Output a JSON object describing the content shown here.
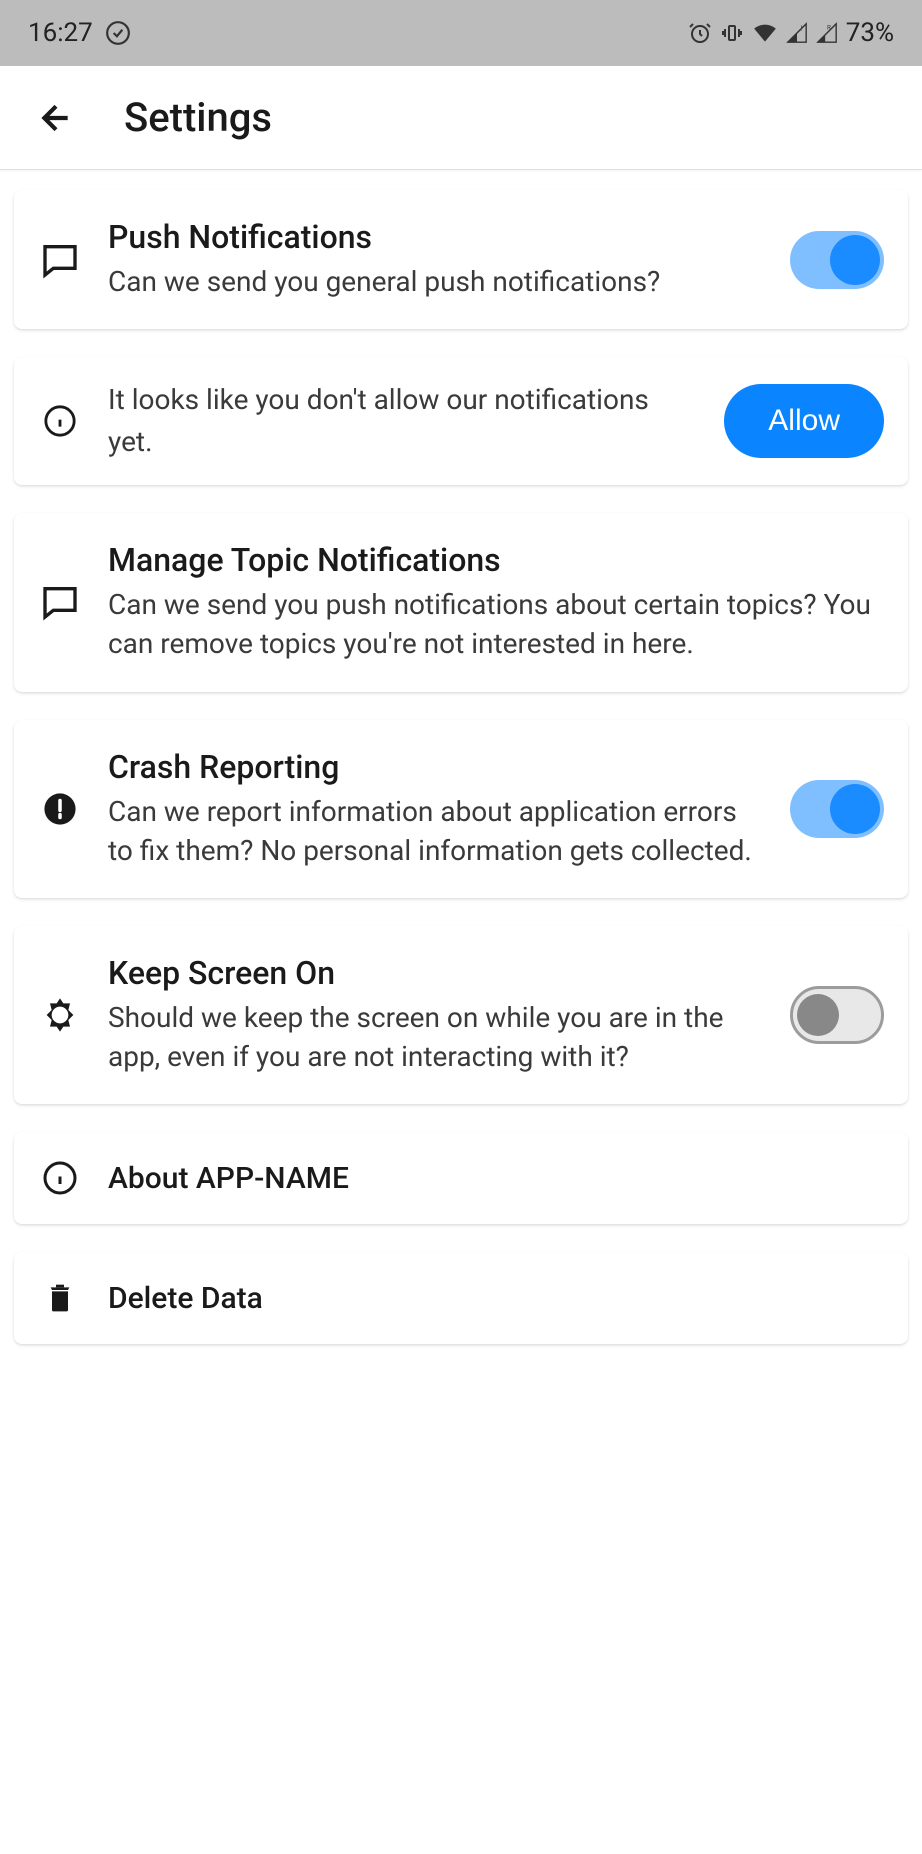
{
  "status_bar": {
    "time": "16:27",
    "battery": "73%"
  },
  "header": {
    "title": "Settings"
  },
  "settings": {
    "push_notifications": {
      "title": "Push Notifications",
      "subtitle": "Can we send you general push notifications?",
      "enabled": true
    },
    "notification_prompt": {
      "text": "It looks like you don't allow our notifications yet.",
      "button": "Allow"
    },
    "topic_notifications": {
      "title": "Manage Topic Notifications",
      "subtitle": "Can we send you push notifications about certain topics? You can remove topics you're not interested in here."
    },
    "crash_reporting": {
      "title": "Crash Reporting",
      "subtitle": "Can we report information about application errors to fix them? No personal information gets collected.",
      "enabled": true
    },
    "keep_screen_on": {
      "title": "Keep Screen On",
      "subtitle": "Should we keep the screen on while you are in the app, even if you are not interacting with it?",
      "enabled": false
    },
    "about": {
      "title": "About APP-NAME"
    },
    "delete_data": {
      "title": "Delete Data"
    }
  }
}
